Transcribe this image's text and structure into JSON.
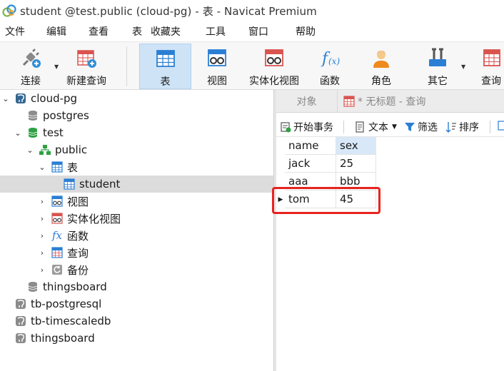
{
  "window": {
    "title": "student @test.public (cloud-pg) - 表 - Navicat Premium"
  },
  "menu": [
    "文件",
    "编辑",
    "查看",
    "表",
    "收藏夹",
    "工具",
    "窗口",
    "帮助"
  ],
  "toolbar": {
    "connect": "连接",
    "new_query": "新建查询",
    "table": "表",
    "view": "视图",
    "materialized_view": "实体化视图",
    "function": "函数",
    "role": "角色",
    "other": "其它",
    "query": "查询"
  },
  "tree": {
    "items": [
      {
        "label": "cloud-pg"
      },
      {
        "label": "postgres"
      },
      {
        "label": "test"
      },
      {
        "label": "public"
      },
      {
        "label": "表"
      },
      {
        "label": "student"
      },
      {
        "label": "视图"
      },
      {
        "label": "实体化视图"
      },
      {
        "label": "函数"
      },
      {
        "label": "查询"
      },
      {
        "label": "备份"
      },
      {
        "label": "thingsboard"
      },
      {
        "label": "tb-postgresql"
      },
      {
        "label": "tb-timescaledb"
      },
      {
        "label": "thingsboard"
      }
    ]
  },
  "tabs": {
    "objects": "对象",
    "query_tab": "* 无标题 - 查询"
  },
  "subtoolbar": {
    "begin_transaction": "开始事务",
    "text": "文本",
    "filter": "筛选",
    "sort": "排序"
  },
  "grid": {
    "columns": [
      "name",
      "sex"
    ],
    "rows": [
      [
        "jack",
        "25"
      ],
      [
        "aaa",
        "bbb"
      ],
      [
        "tom",
        "45"
      ]
    ]
  },
  "colors": {
    "highlight": "#e8231f",
    "selection": "#cfe3f7"
  }
}
